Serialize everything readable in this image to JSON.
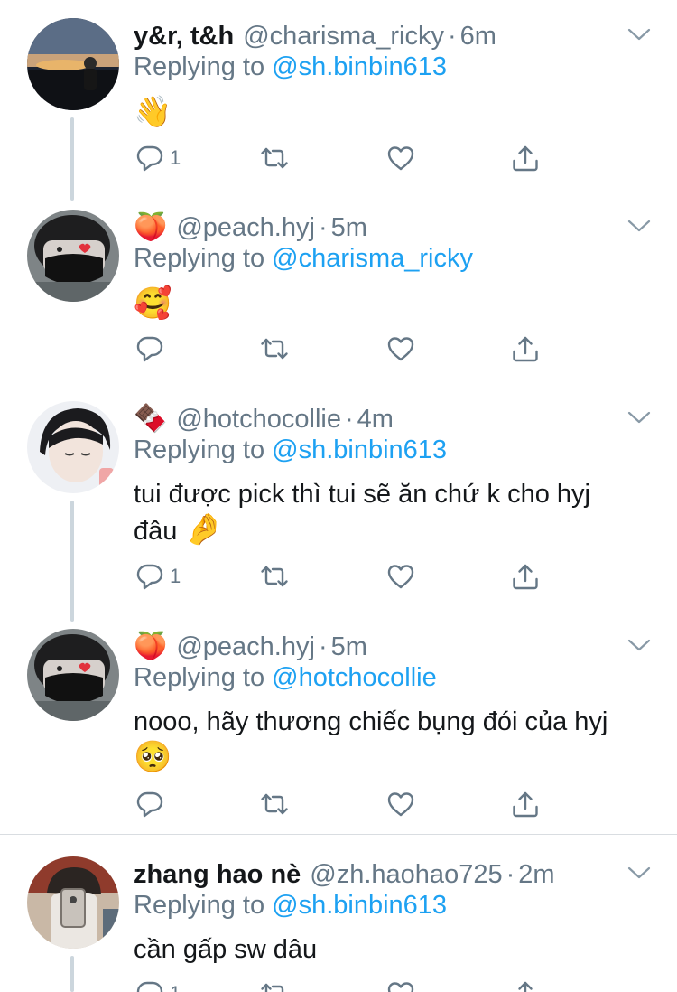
{
  "replying_label": "Replying to",
  "tweets": [
    {
      "name": "y&r, t&h",
      "handle": "@charisma_ricky",
      "time": "6m",
      "reply_to": "@sh.binbin613",
      "text": "👋",
      "reply_count": "1"
    },
    {
      "name_emoji": "🍑",
      "handle": "@peach.hyj",
      "time": "5m",
      "reply_to": "@charisma_ricky",
      "text": "🥰",
      "reply_count": ""
    },
    {
      "name_emoji": "🍫",
      "handle": "@hotchocollie",
      "time": "4m",
      "reply_to": "@sh.binbin613",
      "text_line1": "tui được pick thì tui sẽ ăn chứ k cho hyj",
      "text_line2": "đâu",
      "text_emoji": "🤌",
      "reply_count": "1"
    },
    {
      "name_emoji": "🍑",
      "handle": "@peach.hyj",
      "time": "5m",
      "reply_to": "@hotchocollie",
      "text_line1": "nooo, hãy thương chiếc bụng đói của hyj",
      "text_emoji": "🥺",
      "reply_count": ""
    },
    {
      "name": "zhang hao nè",
      "handle": "@zh.haohao725",
      "time": "2m",
      "reply_to": "@sh.binbin613",
      "text": "cần gấp sw dâu",
      "reply_count": "1"
    }
  ],
  "colors": {
    "link": "#1da1f2",
    "secondary": "#657786",
    "text": "#14171a",
    "thread_line": "#ccd6dd"
  },
  "icons": [
    "reply-icon",
    "retweet-icon",
    "like-icon",
    "share-icon",
    "chevron-down-icon"
  ]
}
